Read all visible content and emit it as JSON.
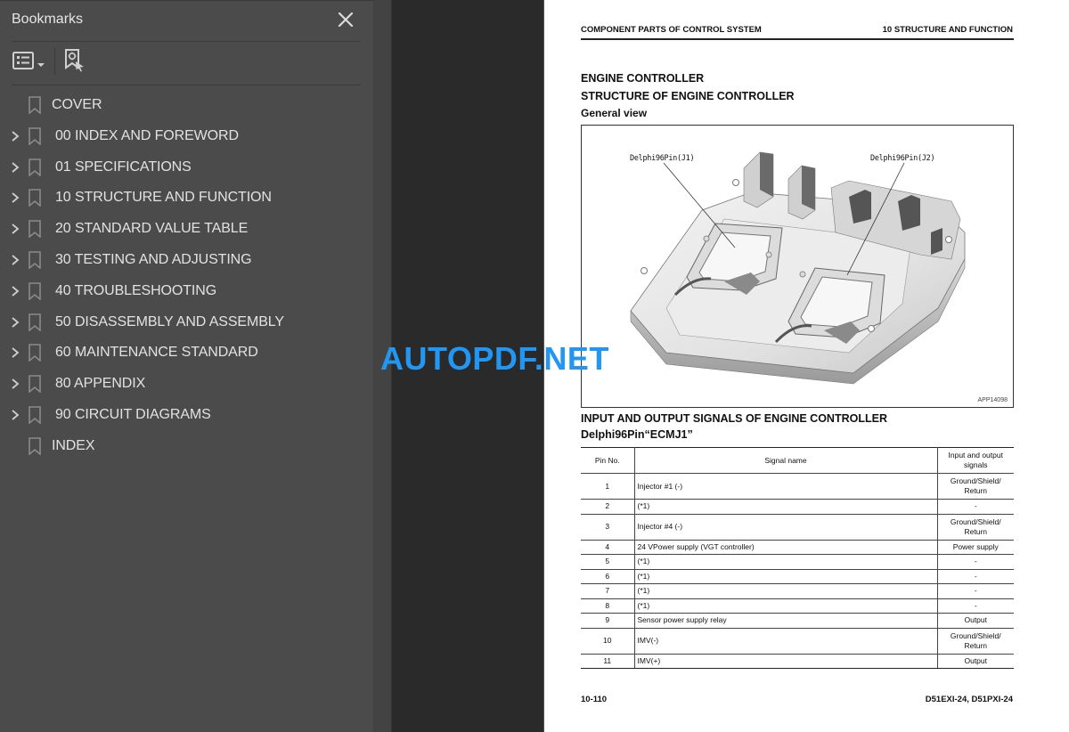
{
  "sidebar": {
    "title": "Bookmarks",
    "close_icon": "close-icon",
    "toolbar": {
      "options_icon": "list-options-icon",
      "find_bookmark_icon": "find-current-bookmark-icon"
    },
    "items": [
      {
        "label": "COVER",
        "expandable": false
      },
      {
        "label": "00 INDEX AND FOREWORD",
        "expandable": true
      },
      {
        "label": "01 SPECIFICATIONS",
        "expandable": true
      },
      {
        "label": "10 STRUCTURE AND FUNCTION",
        "expandable": true
      },
      {
        "label": "20 STANDARD VALUE TABLE",
        "expandable": true
      },
      {
        "label": "30 TESTING AND ADJUSTING",
        "expandable": true
      },
      {
        "label": "40 TROUBLESHOOTING",
        "expandable": true
      },
      {
        "label": "50 DISASSEMBLY AND ASSEMBLY",
        "expandable": true
      },
      {
        "label": "60 MAINTENANCE STANDARD",
        "expandable": true
      },
      {
        "label": "80 APPENDIX",
        "expandable": true
      },
      {
        "label": "90 CIRCUIT DIAGRAMS",
        "expandable": true
      },
      {
        "label": "INDEX",
        "expandable": false
      }
    ]
  },
  "page": {
    "header_left": "COMPONENT PARTS OF CONTROL SYSTEM",
    "header_right": "10 STRUCTURE AND FUNCTION",
    "heading1": "ENGINE CONTROLLER",
    "heading2": "STRUCTURE OF ENGINE CONTROLLER",
    "heading3": "General view",
    "figure": {
      "label_j1": "Delphi96Pin(J1)",
      "label_j2": "Delphi96Pin(J2)",
      "code": "APP14098"
    },
    "heading4": "INPUT AND OUTPUT SIGNALS OF ENGINE CONTROLLER",
    "heading5": "Delphi96Pin“ECMJ1”",
    "table": {
      "headers": [
        "Pin No.",
        "Signal name",
        "Input and output signals"
      ],
      "rows": [
        {
          "pin": "1",
          "name": "Injector #1 (-)",
          "io": "Ground/Shield/ Return"
        },
        {
          "pin": "2",
          "name": "(*1)",
          "io": "-"
        },
        {
          "pin": "3",
          "name": "Injector #4 (-)",
          "io": "Ground/Shield/ Return"
        },
        {
          "pin": "4",
          "name": "24 VPower supply (VGT controller)",
          "io": "Power supply"
        },
        {
          "pin": "5",
          "name": "(*1)",
          "io": "-"
        },
        {
          "pin": "6",
          "name": "(*1)",
          "io": "-"
        },
        {
          "pin": "7",
          "name": "(*1)",
          "io": "-"
        },
        {
          "pin": "8",
          "name": "(*1)",
          "io": "-"
        },
        {
          "pin": "9",
          "name": "Sensor power supply relay",
          "io": "Output"
        },
        {
          "pin": "10",
          "name": "IMV(-)",
          "io": "Ground/Shield/ Return"
        },
        {
          "pin": "11",
          "name": "IMV(+)",
          "io": "Output"
        }
      ]
    },
    "footer_left": "10-110",
    "footer_right": "D51EXI-24, D51PXI-24"
  },
  "watermark": "AUTOPDF.NET",
  "colors": {
    "sidebar_bg": "#4b4b4b",
    "viewer_bg": "#2a2a2a",
    "watermark": "#2196f3"
  }
}
